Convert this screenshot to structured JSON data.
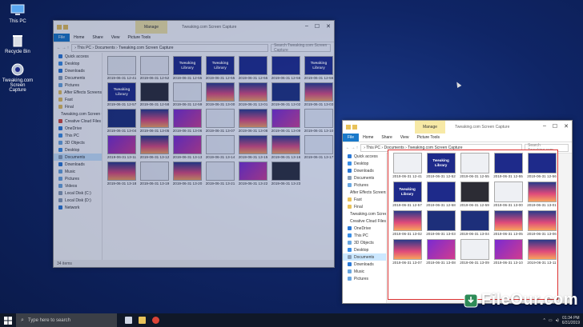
{
  "desktop": {
    "icons": [
      {
        "label": "This PC",
        "icon": "this-pc-icon"
      },
      {
        "label": "Recycle Bin",
        "icon": "recycle-bin-icon"
      },
      {
        "label": "Tweaking.com\nScreen Capture",
        "icon": "capture-app-icon"
      }
    ]
  },
  "window_bg": {
    "title": "Tweaking.com Screen Capture",
    "context_tab": "Manage",
    "ribbon_tabs": [
      "File",
      "Home",
      "Share",
      "View",
      "Picture Tools"
    ],
    "address": "› This PC › Documents › Tweaking.com Screen Capture",
    "search_placeholder": "Search Tweaking.com Screen Capture",
    "nav": [
      {
        "label": "Quick access",
        "color": "#2b79d6"
      },
      {
        "label": "Desktop",
        "color": "#3a8ee6"
      },
      {
        "label": "Downloads",
        "color": "#2b79d6"
      },
      {
        "label": "Documents",
        "color": "#8aa0b8"
      },
      {
        "label": "Pictures",
        "color": "#6aa7e0"
      },
      {
        "label": "After Effects Screens",
        "color": "#e8c25a"
      },
      {
        "label": "Fast",
        "color": "#e8c25a"
      },
      {
        "label": "Final",
        "color": "#e8c25a"
      },
      {
        "label": "Tweaking.com Screen Capture",
        "color": "#e8c25a"
      },
      {
        "label": "Creative Cloud Files",
        "color": "#d94a3a"
      },
      {
        "label": "OneDrive",
        "color": "#2b79d6"
      },
      {
        "label": "This PC",
        "color": "#3a8ee6"
      },
      {
        "label": "3D Objects",
        "color": "#6aa7e0"
      },
      {
        "label": "Desktop",
        "color": "#3a8ee6"
      },
      {
        "label": "Documents",
        "color": "#8aa0b8"
      },
      {
        "label": "Downloads",
        "color": "#2b79d6"
      },
      {
        "label": "Music",
        "color": "#6aa7e0"
      },
      {
        "label": "Pictures",
        "color": "#6aa7e0"
      },
      {
        "label": "Videos",
        "color": "#6aa7e0"
      },
      {
        "label": "Local Disk (C:)",
        "color": "#8aa0b8"
      },
      {
        "label": "Local Disk (D:)",
        "color": "#8aa0b8"
      },
      {
        "label": "Network",
        "color": "#2b79d6"
      }
    ],
    "selected_nav_index": 14,
    "files": [
      {
        "name": "2019-06-31 12-41",
        "style": "t-white",
        "sub": ""
      },
      {
        "name": "2019-06-31 12-52",
        "style": "t-white",
        "sub": ""
      },
      {
        "name": "Tweaking Library",
        "style": "t-lib",
        "sub": "2019-06-31 12-55"
      },
      {
        "name": "Tweaking Library",
        "style": "t-lib",
        "sub": "2019-06-31 12-55"
      },
      {
        "name": "2019-06-31 12-55",
        "style": "t-blue",
        "sub": ""
      },
      {
        "name": "2019-06-31 12-56",
        "style": "t-blue",
        "sub": ""
      },
      {
        "name": "Tweaking Library",
        "style": "t-lib",
        "sub": "2019-06-31 12-56"
      },
      {
        "name": "Tweaking Library",
        "style": "t-lib",
        "sub": "2019-06-31 12-57"
      },
      {
        "name": "2019-06-31 12-58",
        "style": "t-dark",
        "sub": ""
      },
      {
        "name": "2019-06-31 12-59",
        "style": "t-white",
        "sub": ""
      },
      {
        "name": "2019-06-31 13-00",
        "style": "t-pink",
        "sub": ""
      },
      {
        "name": "2019-06-31 13-01",
        "style": "t-pink",
        "sub": ""
      },
      {
        "name": "2019-06-31 13-02",
        "style": "t-film",
        "sub": ""
      },
      {
        "name": "2019-06-31 13-03",
        "style": "t-pink",
        "sub": ""
      },
      {
        "name": "2019-06-31 13-04",
        "style": "t-film",
        "sub": ""
      },
      {
        "name": "2019-06-31 13-05",
        "style": "t-pink",
        "sub": ""
      },
      {
        "name": "2019-06-31 13-06",
        "style": "t-purple",
        "sub": ""
      },
      {
        "name": "2019-06-31 13-07",
        "style": "t-white",
        "sub": ""
      },
      {
        "name": "2019-06-31 13-08",
        "style": "t-pink",
        "sub": ""
      },
      {
        "name": "2019-06-31 13-09",
        "style": "t-purple",
        "sub": ""
      },
      {
        "name": "2019-06-31 13-10",
        "style": "t-white",
        "sub": ""
      },
      {
        "name": "2019-06-31 13-11",
        "style": "t-purple",
        "sub": ""
      },
      {
        "name": "2019-06-31 13-12",
        "style": "t-pink",
        "sub": ""
      },
      {
        "name": "2019-06-31 13-13",
        "style": "t-purple",
        "sub": ""
      },
      {
        "name": "2019-06-31 13-14",
        "style": "t-white",
        "sub": ""
      },
      {
        "name": "2019-06-31 13-15",
        "style": "t-pink",
        "sub": ""
      },
      {
        "name": "2019-06-31 13-16",
        "style": "t-pink",
        "sub": ""
      },
      {
        "name": "2019-06-31 13-17",
        "style": "t-white",
        "sub": ""
      },
      {
        "name": "2019-06-31 13-18",
        "style": "t-pink",
        "sub": ""
      },
      {
        "name": "2019-06-31 13-19",
        "style": "t-white",
        "sub": ""
      },
      {
        "name": "2019-06-31 13-20",
        "style": "t-pink",
        "sub": ""
      },
      {
        "name": "2019-06-31 13-21",
        "style": "t-white",
        "sub": ""
      },
      {
        "name": "2019-06-31 13-22",
        "style": "t-purple",
        "sub": ""
      },
      {
        "name": "2019-06-31 13-23",
        "style": "t-dark",
        "sub": ""
      }
    ],
    "status": "34 items"
  },
  "window_fg": {
    "title": "Tweaking.com Screen Capture",
    "context_tab": "Manage",
    "ribbon_tabs": [
      "File",
      "Home",
      "Share",
      "View",
      "Picture Tools"
    ],
    "address": "› This PC › Documents › Tweaking.com Screen Capture",
    "search_placeholder": "Search Tweaking.com...",
    "nav": [
      {
        "label": "Quick access",
        "color": "#2b79d6"
      },
      {
        "label": "Desktop",
        "color": "#3a8ee6"
      },
      {
        "label": "Downloads",
        "color": "#2b79d6"
      },
      {
        "label": "Documents",
        "color": "#8aa0b8"
      },
      {
        "label": "Pictures",
        "color": "#6aa7e0"
      },
      {
        "label": "After Effects Screens",
        "color": "#e8c25a"
      },
      {
        "label": "Fast",
        "color": "#e8c25a"
      },
      {
        "label": "Final",
        "color": "#e8c25a"
      },
      {
        "label": "Tweaking.com Screen Capture",
        "color": "#e8c25a"
      },
      {
        "label": "Creative Cloud Files",
        "color": "#d94a3a"
      },
      {
        "label": "OneDrive",
        "color": "#2b79d6"
      },
      {
        "label": "This PC",
        "color": "#3a8ee6"
      },
      {
        "label": "3D Objects",
        "color": "#6aa7e0"
      },
      {
        "label": "Desktop",
        "color": "#3a8ee6"
      },
      {
        "label": "Documents",
        "color": "#8aa0b8"
      },
      {
        "label": "Downloads",
        "color": "#2b79d6"
      },
      {
        "label": "Music",
        "color": "#6aa7e0"
      },
      {
        "label": "Pictures",
        "color": "#6aa7e0"
      }
    ],
    "selected_nav_index": 14,
    "files": [
      {
        "name": "2019-06-31 12-41",
        "style": "t-white",
        "sub": ""
      },
      {
        "name": "Tweaking Library",
        "style": "t-lib",
        "sub": "2019-06-31 12-52"
      },
      {
        "name": "2019-06-31 12-55",
        "style": "t-white",
        "sub": ""
      },
      {
        "name": "2019-06-31 12-55",
        "style": "t-blue",
        "sub": ""
      },
      {
        "name": "2019-06-31 12-56",
        "style": "t-blue",
        "sub": ""
      },
      {
        "name": "Tweaking Library",
        "style": "t-lib",
        "sub": "2019-06-31 12-57"
      },
      {
        "name": "2019-06-31 12-58",
        "style": "t-blue",
        "sub": ""
      },
      {
        "name": "2019-06-31 12-59",
        "style": "t-dark",
        "sub": ""
      },
      {
        "name": "2019-06-31 13-00",
        "style": "t-white",
        "sub": ""
      },
      {
        "name": "2019-06-31 13-01",
        "style": "t-pink",
        "sub": ""
      },
      {
        "name": "2019-06-31 13-02",
        "style": "t-pink",
        "sub": ""
      },
      {
        "name": "2019-06-31 13-03",
        "style": "t-film",
        "sub": ""
      },
      {
        "name": "2019-06-31 13-04",
        "style": "t-film",
        "sub": ""
      },
      {
        "name": "2019-06-31 13-05",
        "style": "t-pink",
        "sub": ""
      },
      {
        "name": "2019-06-31 13-06",
        "style": "t-pink",
        "sub": ""
      },
      {
        "name": "2019-06-31 13-07",
        "style": "t-pink",
        "sub": ""
      },
      {
        "name": "2019-06-31 13-08",
        "style": "t-purple",
        "sub": ""
      },
      {
        "name": "2019-06-31 13-09",
        "style": "t-white",
        "sub": ""
      },
      {
        "name": "2019-06-31 13-10",
        "style": "t-purple",
        "sub": ""
      },
      {
        "name": "2019-06-31 13-11",
        "style": "t-pink",
        "sub": ""
      }
    ],
    "status": "34 items"
  },
  "taskbar": {
    "search_placeholder": "Type here to search",
    "pinned": [
      {
        "icon": "task-view-icon",
        "color": "#cfd6e4"
      },
      {
        "icon": "file-explorer-icon",
        "color": "#e8c25a"
      },
      {
        "icon": "chrome-icon",
        "color": "#db4437"
      }
    ],
    "clock": "01:34 PM",
    "date": "6/31/2019"
  },
  "watermark": "FileOur.com",
  "accent": "#1979ca"
}
